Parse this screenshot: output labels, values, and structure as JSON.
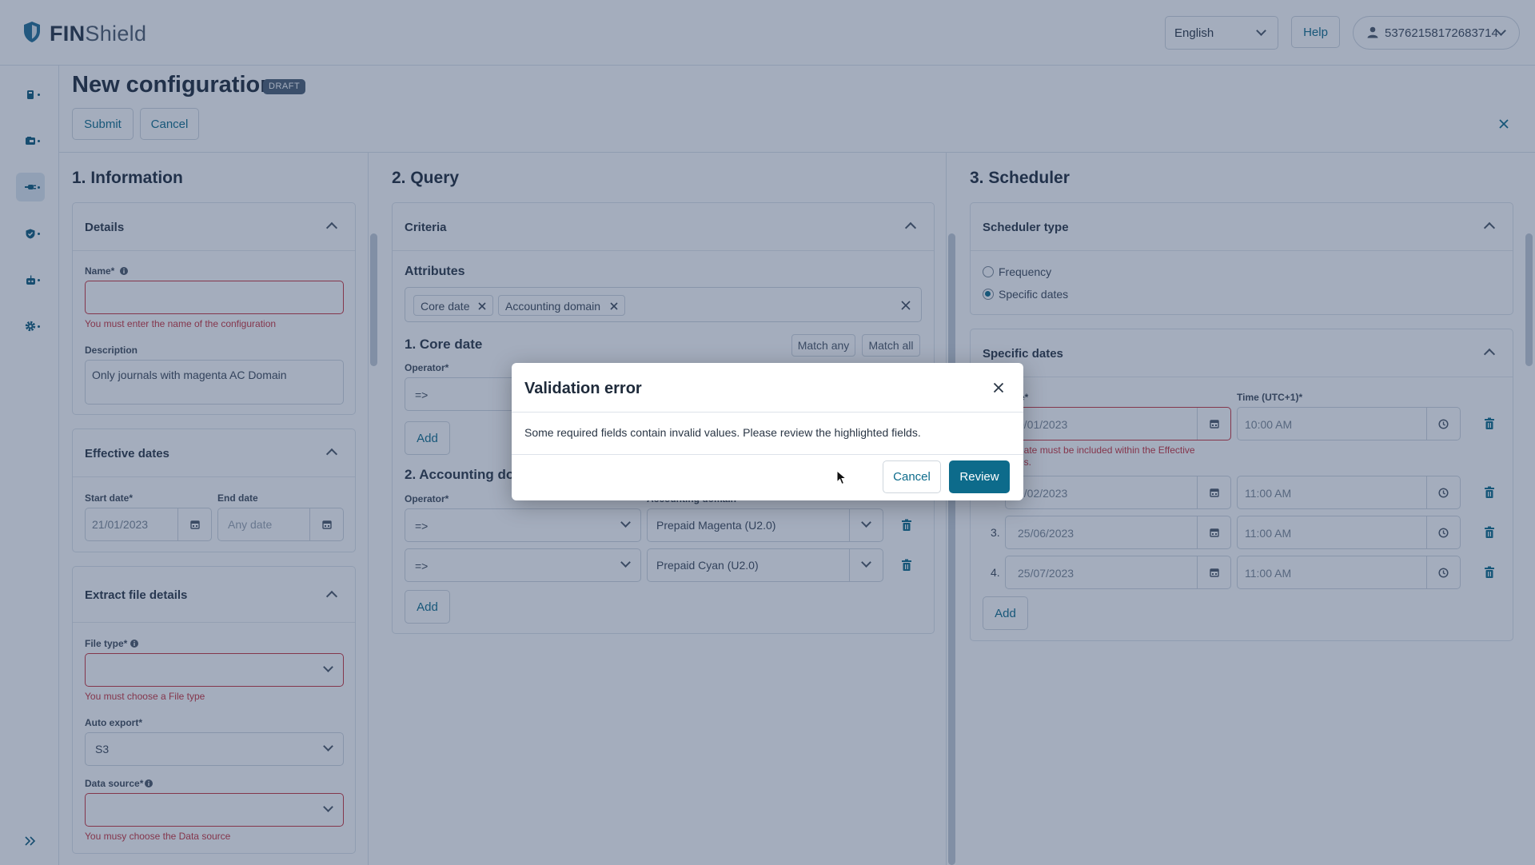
{
  "app": {
    "logo_bold": "FIN",
    "logo_rest": "Shield"
  },
  "header": {
    "language": "English",
    "help": "Help",
    "user_id": "53762158172683714"
  },
  "page": {
    "title": "New configuration",
    "badge": "DRAFT",
    "submit": "Submit",
    "cancel": "Cancel"
  },
  "info": {
    "title": "1. Information",
    "details": {
      "header": "Details",
      "name_label": "Name*",
      "name_error": "You must enter the name of the configuration",
      "desc_label": "Description",
      "desc_value": "Only journals with magenta AC Domain"
    },
    "dates": {
      "header": "Effective dates",
      "start_label": "Start date*",
      "start_value": "21/01/2023",
      "end_label": "End date",
      "end_placeholder": "Any date"
    },
    "extract": {
      "header": "Extract file details",
      "filetype_label": "File type*",
      "filetype_error": "You must choose a File type",
      "auto_label": "Auto export*",
      "auto_value": "S3",
      "source_label": "Data source*",
      "source_error": "You musy choose the Data source"
    }
  },
  "query": {
    "title": "2. Query",
    "criteria_header": "Criteria",
    "attributes_label": "Attributes",
    "chips": [
      "Core date",
      "Accounting domain"
    ],
    "core": {
      "title": "1. Core date",
      "match_any": "Match any",
      "match_all": "Match all",
      "operator_label": "Operator*",
      "operator_value": "=>",
      "add": "Add"
    },
    "accounting": {
      "title": "2. Accounting dom",
      "operator_label": "Operator*",
      "domain_label": "Accounting domain",
      "rows": [
        {
          "operator": "=>",
          "value": "Prepaid Magenta (U2.0)"
        },
        {
          "operator": "=>",
          "value": "Prepaid Cyan (U2.0)"
        }
      ],
      "add": "Add"
    }
  },
  "scheduler": {
    "title": "3. Scheduler",
    "type_header": "Scheduler type",
    "options": [
      "Frequency",
      "Specific dates"
    ],
    "selected": "Specific dates",
    "dates_header": "Specific dates",
    "date_label": "e*",
    "time_label": "Time (UTC+1)*",
    "error_line1": "date must be included within the Effective",
    "error_line2": "es.",
    "rows": [
      {
        "num": "",
        "date": "0/01/2023",
        "time": "10:00 AM"
      },
      {
        "num": "",
        "date": "9/02/2023",
        "time": "11:00 AM"
      },
      {
        "num": "3.",
        "date": "25/06/2023",
        "time": "11:00 AM"
      },
      {
        "num": "4.",
        "date": "25/07/2023",
        "time": "11:00 AM"
      }
    ],
    "add": "Add"
  },
  "modal": {
    "title": "Validation error",
    "body": "Some required fields contain invalid values. Please review the highlighted fields.",
    "cancel": "Cancel",
    "review": "Review"
  },
  "colors": {
    "accent": "#0d6b8b",
    "error": "#c9323d",
    "overlay": "rgba(38,60,98,0.42)"
  },
  "icons": [
    "shield-logo-icon",
    "chevron-down-icon",
    "user-icon",
    "close-icon",
    "calendar-icon",
    "clock-icon",
    "trash-icon",
    "info-icon",
    "expand-sidebar-icon"
  ]
}
